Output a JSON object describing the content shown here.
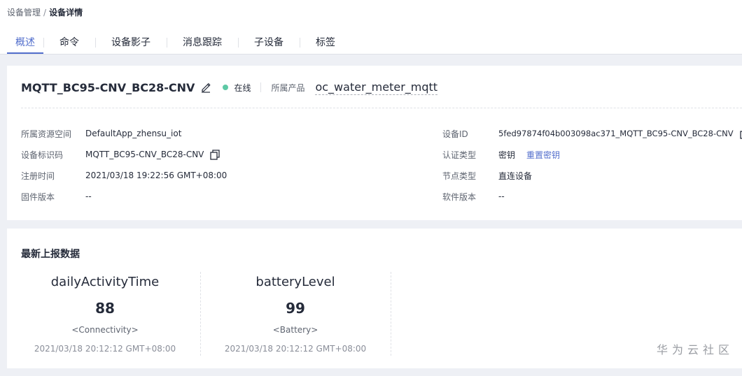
{
  "breadcrumb": {
    "parent": "设备管理",
    "separator": "/",
    "current": "设备详情"
  },
  "tabs": [
    "概述",
    "命令",
    "设备影子",
    "消息跟踪",
    "子设备",
    "标签"
  ],
  "device": {
    "name": "MQTT_BC95-CNV_BC28-CNV",
    "status": "在线",
    "status_color": "#5dc9a5",
    "product_label": "所属产品",
    "product_value": "oc_water_meter_mqtt"
  },
  "info_left": [
    {
      "label": "所属资源空间",
      "value": "DefaultApp_zhensu_iot"
    },
    {
      "label": "设备标识码",
      "value": "MQTT_BC95-CNV_BC28-CNV"
    },
    {
      "label": "注册时间",
      "value": "2021/03/18 19:22:56 GMT+08:00"
    },
    {
      "label": "固件版本",
      "value": "--"
    }
  ],
  "info_right": [
    {
      "label": "设备ID",
      "value": "5fed97874f04b003098ac371_MQTT_BC95-CNV_BC28-CNV"
    },
    {
      "label": "认证类型",
      "value": "密钥",
      "link": "重置密钥"
    },
    {
      "label": "节点类型",
      "value": "直连设备"
    },
    {
      "label": "软件版本",
      "value": "--"
    }
  ],
  "latest": {
    "title": "最新上报数据",
    "items": [
      {
        "name": "dailyActivityTime",
        "value": "88",
        "service": "<Connectivity>",
        "time": "2021/03/18 20:12:12 GMT+08:00"
      },
      {
        "name": "batteryLevel",
        "value": "99",
        "service": "<Battery>",
        "time": "2021/03/18 20:12:12 GMT+08:00"
      }
    ]
  },
  "watermark": "华为云社区",
  "colors": {
    "accent": "#526ecc",
    "online": "#5dc9a5",
    "background": "#eef0f5"
  },
  "icons": {
    "edit": "edit-icon",
    "copy": "copy-icon"
  }
}
